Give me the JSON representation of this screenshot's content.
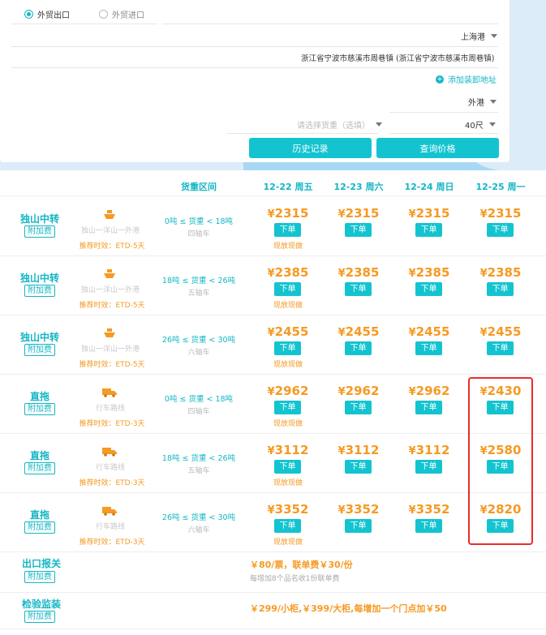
{
  "form": {
    "radio_export": "外贸出口",
    "radio_import": "外贸进口",
    "port": "上海港",
    "address": "浙江省宁波市慈溪市周巷镇 (浙江省宁波市慈溪市周巷镇)",
    "add_address": "添加装卸地址",
    "port_type": "外港",
    "weight_placeholder": "请选择货重（选填）",
    "container": "40尺",
    "history_button": "历史记录",
    "query_button": "查询价格"
  },
  "table": {
    "header_weight": "货重区间",
    "dates": [
      "12-22 周五",
      "12-23 周六",
      "12-24 周日",
      "12-25 周一"
    ],
    "order_label": "下单",
    "cash_label": "现放现做",
    "fee_label": "附加费",
    "currency": "¥",
    "rows": [
      {
        "route": "独山中转",
        "mode": "ship",
        "path": "独山一洋山一外港",
        "eta": "推荐时效：ETD-5天",
        "weight": "0吨 ≤ 货重 < 18吨",
        "axle": "四轴车",
        "prices": [
          "2315",
          "2315",
          "2315",
          "2315"
        ]
      },
      {
        "route": "独山中转",
        "mode": "ship",
        "path": "独山一洋山一外港",
        "eta": "推荐时效：ETD-5天",
        "weight": "18吨 ≤ 货重 < 26吨",
        "axle": "五轴车",
        "prices": [
          "2385",
          "2385",
          "2385",
          "2385"
        ]
      },
      {
        "route": "独山中转",
        "mode": "ship",
        "path": "独山一洋山一外港",
        "eta": "推荐时效：ETD-5天",
        "weight": "26吨 ≤ 货重 < 30吨",
        "axle": "六轴车",
        "prices": [
          "2455",
          "2455",
          "2455",
          "2455"
        ]
      },
      {
        "route": "直拖",
        "mode": "truck",
        "path": "行车路线",
        "eta": "推荐时效：ETD-3天",
        "weight": "0吨 ≤ 货重 < 18吨",
        "axle": "四轴车",
        "prices": [
          "2962",
          "2962",
          "2962",
          "2430"
        ]
      },
      {
        "route": "直拖",
        "mode": "truck",
        "path": "行车路线",
        "eta": "推荐时效：ETD-3天",
        "weight": "18吨 ≤ 货重 < 26吨",
        "axle": "五轴车",
        "prices": [
          "3112",
          "3112",
          "3112",
          "2580"
        ]
      },
      {
        "route": "直拖",
        "mode": "truck",
        "path": "行车路线",
        "eta": "推荐时效：ETD-3天",
        "weight": "26吨 ≤ 货重 < 30吨",
        "axle": "六轴车",
        "prices": [
          "3352",
          "3352",
          "3352",
          "2820"
        ]
      }
    ]
  },
  "extras": {
    "customs_name": "出口报关",
    "customs_text": "￥80/票，联单费￥30/份",
    "customs_sub": "每增加8个品名收1份联单费",
    "inspection_name": "检验监装",
    "inspection_text": "￥299/小柜,￥399/大柜,每增加一个门点加￥50"
  },
  "colors": {
    "accent": "#13c4d0",
    "price": "#f59a23",
    "highlight": "#ea2b2b"
  }
}
